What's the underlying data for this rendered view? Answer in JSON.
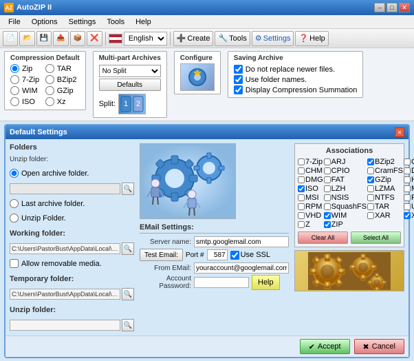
{
  "titleBar": {
    "title": "AutoZIP II",
    "icon": "AZ",
    "buttons": [
      "minimize",
      "maximize",
      "close"
    ]
  },
  "menuBar": {
    "items": [
      "File",
      "Options",
      "Settings",
      "Tools",
      "Help"
    ]
  },
  "toolbar": {
    "buttons": [
      "new",
      "open",
      "save",
      "extract",
      "separator",
      "create",
      "tools",
      "settings",
      "help"
    ],
    "create_label": "Create",
    "tools_label": "Tools",
    "settings_label": "Settings",
    "help_label": "Help",
    "language": "English"
  },
  "settingsRow": {
    "compression": {
      "title": "Compression Default",
      "options": [
        "Zip",
        "TAR",
        "7-Zip",
        "BZip2",
        "WIM",
        "GZip",
        "ISO",
        "Xz"
      ]
    },
    "multipart": {
      "title": "Multi-part Archives",
      "split_label": "Split:",
      "no_split": "No Split",
      "defaults_btn": "Defaults"
    },
    "configure": {
      "title": "Configure"
    },
    "saving": {
      "title": "Saving Archive",
      "options": [
        "Do not replace newer files.",
        "Use folder names.",
        "Display Compression Summation"
      ]
    }
  },
  "dialog": {
    "title": "Default Settings",
    "folders": {
      "label": "Folders",
      "unzip_label": "Unzip folder:",
      "open_archive": "Open archive folder.",
      "last_archive": "Last archive folder.",
      "unzip_folder": "Unzip Folder.",
      "working_label": "Working folder:",
      "working_path": "C:\\Users\\PastorBust\\AppData\\Local\\A...",
      "allow_removable": "Allow removable media.",
      "temp_label": "Temporary folder:",
      "temp_path": "C:\\Users\\PastorBust\\AppData\\Local\\A...",
      "unzip_path_label": "Unzip folder:"
    },
    "email": {
      "title": "EMail Settings:",
      "server_label": "Server name:",
      "server_value": "smtp.googlemail.com",
      "port_label": "Port #",
      "port_value": "587",
      "use_ssl": "Use SSL",
      "test_btn": "Test Email:",
      "from_label": "From EMail:",
      "from_value": "youraccount@googlemail.com",
      "password_label": "Account Password:",
      "help_btn": "Help"
    },
    "associations": {
      "title": "Associations",
      "items": [
        {
          "label": "7-Zip",
          "checked": false
        },
        {
          "label": "ARJ",
          "checked": false
        },
        {
          "label": "BZip2",
          "checked": true
        },
        {
          "label": "CAB",
          "checked": false
        },
        {
          "label": "CHM",
          "checked": false
        },
        {
          "label": "CPIO",
          "checked": false
        },
        {
          "label": "CramFS",
          "checked": false
        },
        {
          "label": "DEB",
          "checked": false
        },
        {
          "label": "DMG",
          "checked": false
        },
        {
          "label": "FAT",
          "checked": false
        },
        {
          "label": "GZip",
          "checked": true
        },
        {
          "label": "HFS",
          "checked": false
        },
        {
          "label": "ISO",
          "checked": true
        },
        {
          "label": "LZH",
          "checked": false
        },
        {
          "label": "LZMA",
          "checked": false
        },
        {
          "label": "MBR",
          "checked": false
        },
        {
          "label": "MSI",
          "checked": false
        },
        {
          "label": "NSIS",
          "checked": false
        },
        {
          "label": "NTFS",
          "checked": false
        },
        {
          "label": "RAR",
          "checked": false
        },
        {
          "label": "RPM",
          "checked": false
        },
        {
          "label": "SquashFS",
          "checked": false
        },
        {
          "label": "TAR",
          "checked": false
        },
        {
          "label": "UDF",
          "checked": false
        },
        {
          "label": "VHD",
          "checked": false
        },
        {
          "label": "WIM",
          "checked": true
        },
        {
          "label": "XAR",
          "checked": false
        },
        {
          "label": "Xz",
          "checked": true
        },
        {
          "label": "Z",
          "checked": false
        },
        {
          "label": "ZIP",
          "checked": true
        }
      ],
      "clear_btn": "Clear All",
      "select_all_btn": "Select All"
    },
    "bottom": {
      "accept_label": "Accept",
      "cancel_label": "Cancel"
    }
  }
}
